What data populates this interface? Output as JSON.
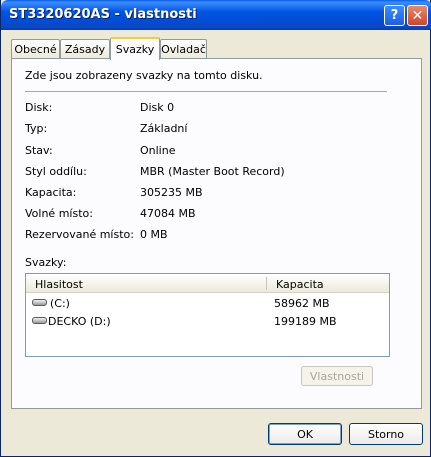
{
  "window": {
    "title": "ST3320620AS - vlastnosti"
  },
  "title_buttons": {
    "help": "?",
    "close": "✕"
  },
  "tabs": [
    {
      "label": "Obecné"
    },
    {
      "label": "Zásady"
    },
    {
      "label": "Svazky",
      "active": true
    },
    {
      "label": "Ovladač"
    }
  ],
  "intro": "Zde jsou zobrazeny svazky na tomto disku.",
  "properties": [
    {
      "label": "Disk:",
      "value": "Disk 0"
    },
    {
      "label": "Typ:",
      "value": "Základní"
    },
    {
      "label": "Stav:",
      "value": "Online"
    },
    {
      "label": "Styl oddílu:",
      "value": "MBR (Master Boot Record)"
    },
    {
      "label": "Kapacita:",
      "value": "305235 MB"
    },
    {
      "label": "Volné místo:",
      "value": "47084 MB"
    },
    {
      "label": "Rezervované místo:",
      "value": "0 MB"
    }
  ],
  "volumes": {
    "label": "Svazky:",
    "columns": [
      "Hlasitost",
      "Kapacita"
    ],
    "rows": [
      {
        "name": "(C:)",
        "capacity": "58962 MB",
        "icon": "drive-icon"
      },
      {
        "name": "DECKO (D:)",
        "capacity": "199189 MB",
        "icon": "drive-icon"
      }
    ]
  },
  "buttons": {
    "properties": "Vlastnosti",
    "ok": "OK",
    "cancel": "Storno"
  }
}
